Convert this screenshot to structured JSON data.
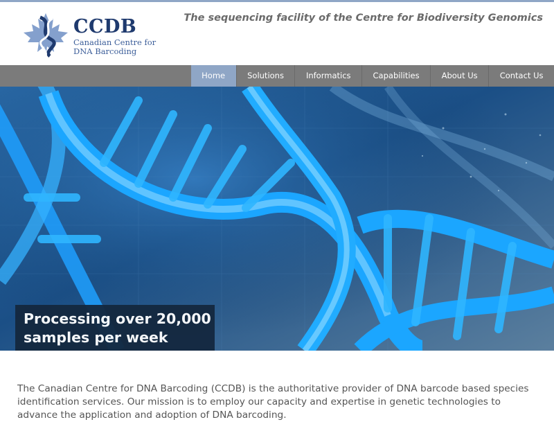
{
  "header": {
    "logo": {
      "acronym": "CCDB",
      "name_line1": "Canadian Centre for",
      "name_line2": "DNA Barcoding",
      "icon": "maple-leaf-dna-icon"
    },
    "tagline": "The sequencing facility of the Centre for Biodiversity Genomics"
  },
  "nav": {
    "items": [
      {
        "label": "Home",
        "active": true
      },
      {
        "label": "Solutions",
        "active": false
      },
      {
        "label": "Informatics",
        "active": false
      },
      {
        "label": "Capabilities",
        "active": false
      },
      {
        "label": "About Us",
        "active": false
      },
      {
        "label": "Contact Us",
        "active": false
      }
    ]
  },
  "hero": {
    "image": "dna-double-helix-image",
    "caption_line1": "Processing over 20,000",
    "caption_line2": "samples per week"
  },
  "intro": {
    "text": "The Canadian Centre for DNA Barcoding (CCDB) is the authoritative provider of DNA barcode based species identification services. Our mission is to employ our capacity and expertise in genetic technologies to advance the application and adoption of DNA barcoding."
  },
  "colors": {
    "accent": "#8fa6c6",
    "nav_bg": "#7b7b7b",
    "brand_navy": "#1f3a6e",
    "caption_bg": "#14283f"
  }
}
